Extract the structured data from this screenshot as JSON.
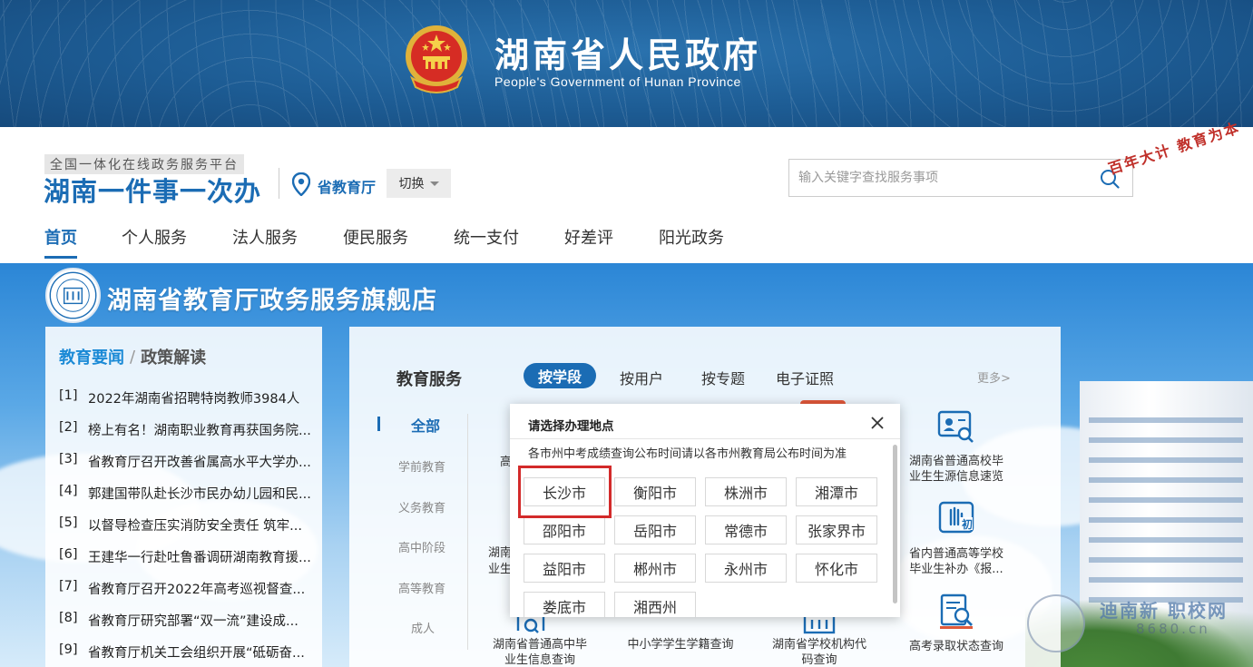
{
  "banner": {
    "title": "湖南省人民政府",
    "subtitle": "People's Government of Hunan Province",
    "emblem": "national-emblem"
  },
  "header": {
    "platform_tag": "全国一体化在线政务服务平台",
    "platform_name": "湖南一件事一次办",
    "location_icon": "map-pin-icon",
    "location": "省教育厅",
    "switch_label": "切换",
    "search": {
      "placeholder": "输入关键字查找服务事项",
      "value": "",
      "icon": "search-icon"
    }
  },
  "nav": [
    "首页",
    "个人服务",
    "法人服务",
    "便民服务",
    "统一支付",
    "好差评",
    "阳光政务"
  ],
  "store": {
    "title": "湖南省教育厅政务服务旗舰店",
    "logo": "hunan-education-dept-logo"
  },
  "news": {
    "tab_a": "教育要闻",
    "separator": "/",
    "tab_b": "政策解读",
    "items": [
      {
        "idx": "[1]",
        "text": "2022年湖南省招聘特岗教师3984人"
      },
      {
        "idx": "[2]",
        "text": "榜上有名！湖南职业教育再获国务院..."
      },
      {
        "idx": "[3]",
        "text": "省教育厅召开改善省属高水平大学办..."
      },
      {
        "idx": "[4]",
        "text": "郭建国带队赴长沙市民办幼儿园和民..."
      },
      {
        "idx": "[5]",
        "text": "以督导检查压实消防安全责任 筑牢..."
      },
      {
        "idx": "[6]",
        "text": "王建华一行赴吐鲁番调研湖南教育援..."
      },
      {
        "idx": "[7]",
        "text": "省教育厅召开2022年高考巡视督查..."
      },
      {
        "idx": "[8]",
        "text": "省教育厅研究部署“双一流”建设成..."
      },
      {
        "idx": "[9]",
        "text": "省教育厅机关工会组织开展“砥砺奋..."
      }
    ]
  },
  "services": {
    "title": "教育服务",
    "tabs": [
      "按学段",
      "按用户",
      "按专题",
      "电子证照"
    ],
    "more": "更多>",
    "side": [
      "全部",
      "学前教育",
      "义务教育",
      "高中阶段",
      "高等教育",
      "成人"
    ],
    "partial_left_1": "高",
    "partial_left_2a": "湖南",
    "partial_left_2b": "业生",
    "cards": [
      {
        "icon": "id-card-search-icon",
        "line1": "湖南省普通高校毕",
        "line2": "业生生源信息速览"
      },
      {
        "icon": "hand-stop-icon",
        "line1": "省内普通高等学校",
        "line2": "毕业生补办《报..."
      },
      {
        "icon": "document-search-icon",
        "line1": "湖南省普通高中毕",
        "line2": "业生信息查询"
      },
      {
        "icon": "student-icon",
        "line1": "中小学学生学籍查询",
        "line2": ""
      },
      {
        "icon": "building-icon",
        "line1": "湖南省学校机构代",
        "line2": "码查询"
      },
      {
        "icon": "report-search-icon",
        "line1": "高考录取状态查询",
        "line2": ""
      }
    ]
  },
  "modal": {
    "title": "请选择办理地点",
    "note": "各市州中考成绩查询公布时间请以各市州教育局公布时间为准",
    "close_icon": "close-icon",
    "cities": [
      "长沙市",
      "衡阳市",
      "株洲市",
      "湘潭市",
      "邵阳市",
      "岳阳市",
      "常德市",
      "张家界市",
      "益阳市",
      "郴州市",
      "永州市",
      "怀化市",
      "娄底市",
      "湘西州"
    ],
    "highlighted": "长沙市"
  },
  "decor": {
    "building_sign": "百年大计 教育为本",
    "watermark_text": "迪南新 职校网",
    "watermark_num": "8680.cn"
  },
  "colors": {
    "brand": "#1b6cb4",
    "banner": "#1d5c94",
    "highlight": "#d32a2a"
  }
}
